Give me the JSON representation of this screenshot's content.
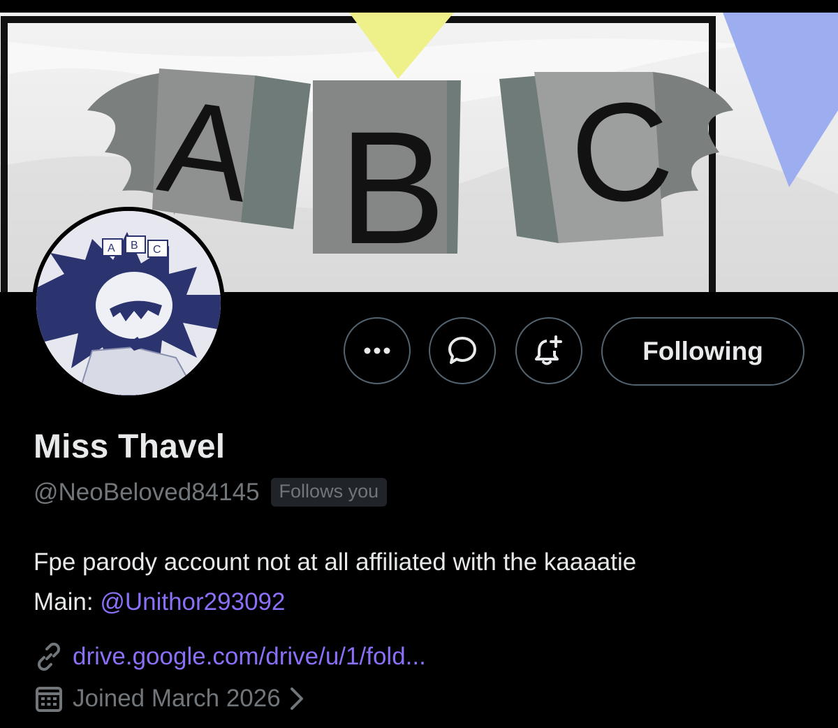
{
  "banner": {
    "blocks": [
      "A",
      "B",
      "C"
    ],
    "colors": {
      "block_face": "#8f9090",
      "block_side": "#6f7b79",
      "wing": "#7b7f7e",
      "pennant_yellow": "#eef08a",
      "pennant_blue": "#9daef0"
    }
  },
  "profile": {
    "display_name": "Miss Thavel",
    "handle": "@NeoBeloved84145",
    "follows_you_badge": "Follows you",
    "bio_line1": "Fpe parody account not at all affiliated with the kaaaatie",
    "bio_main_prefix": "Main: ",
    "bio_main_mention": "@Unithor293092",
    "link": "drive.google.com/drive/u/1/fold...",
    "joined": "Joined March 2026"
  },
  "actions": {
    "more_icon": "more-icon",
    "message_icon": "message-icon",
    "notify_icon": "bell-plus-icon",
    "following_label": "Following"
  },
  "colors": {
    "background": "#000000",
    "primary_text": "#e7e9ea",
    "secondary_text": "#71767b",
    "accent": "#8b6ff7",
    "border": "#536471"
  }
}
